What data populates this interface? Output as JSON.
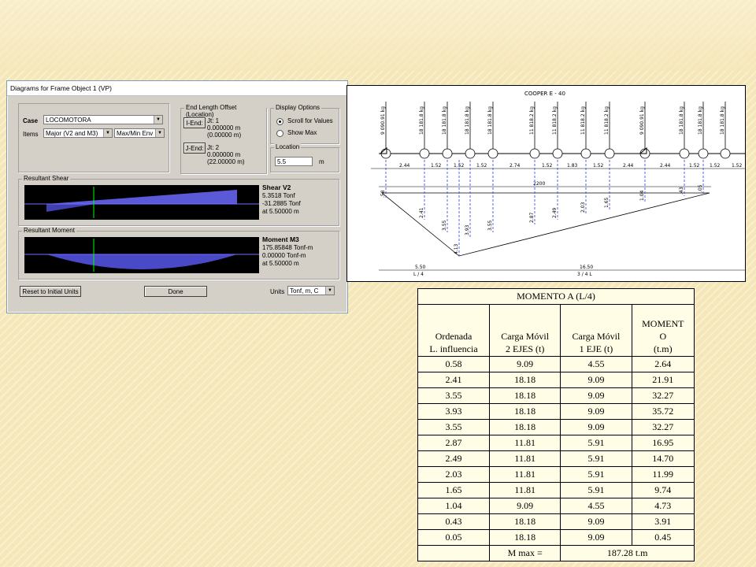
{
  "dialog": {
    "title": "Diagrams for Frame Object 1  (VP)",
    "case_label": "Case",
    "case_value": "LOCOMOTORA",
    "items_label": "Items",
    "items_value": "Major (V2 and M3)",
    "env_value": "Max/Min Env",
    "end_offset": {
      "title": "End Length Offset (Location)",
      "i_end_btn": "I-End:",
      "i_jt": "Jt:  1",
      "i_v1": "0.000000 m",
      "i_v2": "(0.00000 m)",
      "j_end_btn": "J-End:",
      "j_jt": "Jt:  2",
      "j_v1": "0.000000 m",
      "j_v2": "(22.00000 m)"
    },
    "display": {
      "title": "Display Options",
      "opt1": "Scroll for Values",
      "opt2": "Show Max"
    },
    "location": {
      "title": "Location",
      "value": "5.5",
      "unit": "m"
    },
    "shear": {
      "title": "Resultant Shear",
      "head": "Shear V2",
      "v1": "5.3518 Tonf",
      "v2": "-31.2885 Tonf",
      "v3": "at 5.50000 m"
    },
    "moment": {
      "title": "Resultant Moment",
      "head": "Moment M3",
      "v1": "175.85848 Tonf-m",
      "v2": "0.00000 Tonf-m",
      "v3": "at 5.50000 m"
    },
    "reset_btn": "Reset to Initial Units",
    "done_btn": "Done",
    "units_label": "Units",
    "units_value": "Tonf, m, C"
  },
  "drawing": {
    "title": "COOPER  E - 40",
    "loads": [
      "9 090.91 kg",
      "18 181.8 kg",
      "18 181.8 kg",
      "18 181.8 kg",
      "18 181.8 kg",
      "11 818.2 kg",
      "11 818.2 kg",
      "11 818.2 kg",
      "11 818.2 kg",
      "9 090.91 kg",
      "18 181.8 kg",
      "18 181.8 kg",
      "18 181.8 kg"
    ],
    "spacings": [
      "2.44",
      "1.52",
      "1.52",
      "1.52",
      "2.74",
      "1.52",
      "1.83",
      "1.52",
      "2.44",
      "2.44",
      "1.52",
      "1.52",
      "1.52"
    ],
    "span": "2200",
    "ordinates": [
      ".58",
      "2.41",
      "3.55",
      "4.13",
      "3.93",
      "3.55",
      "2.87",
      "2.49",
      "2.03",
      "1.65",
      "1.04",
      ".43",
      ".05"
    ],
    "dim_left": "5.50",
    "dim_left_sub": "L / 4",
    "dim_right": "16.50",
    "dim_right_sub": "3 / 4  L"
  },
  "table": {
    "title": "MOMENTO A (L/4)",
    "headers": [
      "Ordenada\nL. influencia",
      "Carga Móvil\n2 EJES (t)",
      "Carga Móvil\n1 EJE (t)",
      "MOMENT\nO\n(t.m)"
    ],
    "rows": [
      [
        "0.58",
        "9.09",
        "4.55",
        "2.64"
      ],
      [
        "2.41",
        "18.18",
        "9.09",
        "21.91"
      ],
      [
        "3.55",
        "18.18",
        "9.09",
        "32.27"
      ],
      [
        "3.93",
        "18.18",
        "9.09",
        "35.72"
      ],
      [
        "3.55",
        "18.18",
        "9.09",
        "32.27"
      ],
      [
        "2.87",
        "11.81",
        "5.91",
        "16.95"
      ],
      [
        "2.49",
        "11.81",
        "5.91",
        "14.70"
      ],
      [
        "2.03",
        "11.81",
        "5.91",
        "11.99"
      ],
      [
        "1.65",
        "11.81",
        "5.91",
        "9.74"
      ],
      [
        "1.04",
        "9.09",
        "4.55",
        "4.73"
      ],
      [
        "0.43",
        "18.18",
        "9.09",
        "3.91"
      ],
      [
        "0.05",
        "18.18",
        "9.09",
        "0.45"
      ]
    ],
    "total_label": "M max =",
    "total_value": "187.28 t.m"
  }
}
